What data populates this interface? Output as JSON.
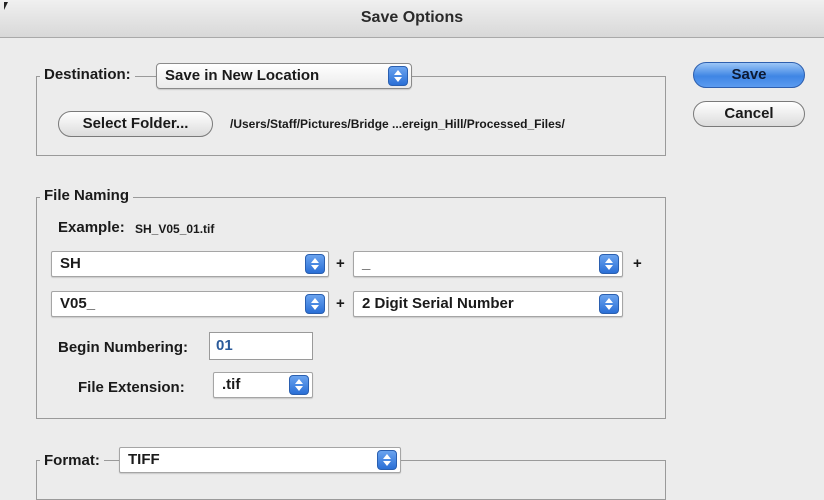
{
  "window": {
    "title": "Save Options"
  },
  "buttons": {
    "save": "Save",
    "cancel": "Cancel"
  },
  "destination": {
    "label": "Destination:",
    "popup_value": "Save in New Location",
    "select_folder": "Select Folder...",
    "path": "/Users/Staff/Pictures/Bridge ...ereign_Hill/Processed_Files/"
  },
  "file_naming": {
    "label": "File Naming",
    "example_label": "Example:",
    "example_value": "SH_V05_01.tif",
    "row1": {
      "left": "SH",
      "right": "_"
    },
    "row2": {
      "left": "V05_",
      "right": "2 Digit Serial Number"
    },
    "plus": "+",
    "begin_numbering_label": "Begin Numbering:",
    "begin_numbering_value": "01",
    "file_extension_label": "File Extension:",
    "file_extension_value": ".tif"
  },
  "format": {
    "label": "Format:",
    "value": "TIFF"
  },
  "icons": {
    "stepper": "popup-stepper-icon"
  },
  "colors": {
    "accent": "#3f86e4",
    "background": "#ececec"
  }
}
